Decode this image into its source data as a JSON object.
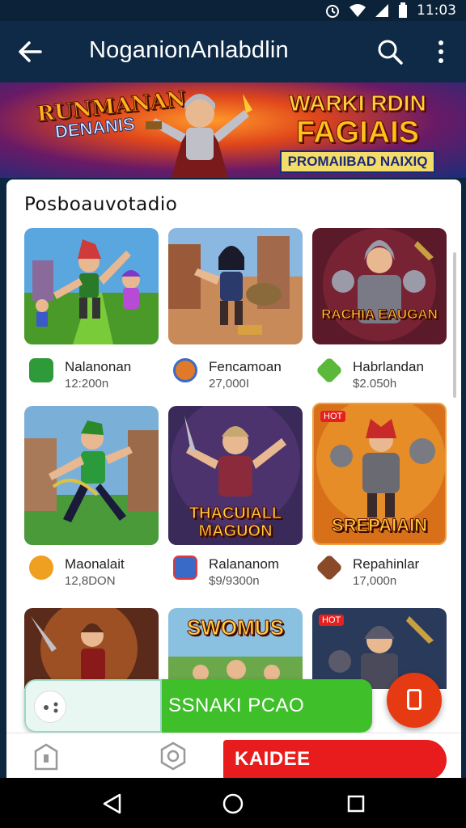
{
  "status": {
    "time": "11:03"
  },
  "app_bar": {
    "title": "NoganionAnlabdlin"
  },
  "banner": {
    "left_logo_line1": "RUNMANAN",
    "left_logo_line2": "DENANIS",
    "promo_line1": "WARKI RDIN",
    "promo_line2": "FAGIAIS",
    "promo_line3": "PROMAIIBAD NAIXIQ"
  },
  "section": {
    "title": "Posboauvotadio"
  },
  "tiles": [
    {
      "name": "Nalanonan",
      "count": "12:200n",
      "thumb_text": ""
    },
    {
      "name": "Fencamoan",
      "count": "27,000I",
      "thumb_text": ""
    },
    {
      "name": "Habrlandan",
      "count": "$2.050h",
      "thumb_text": "RACHIA EAUGAN"
    },
    {
      "name": "Maonalait",
      "count": "12,8DON",
      "thumb_text": ""
    },
    {
      "name": "Ralananom",
      "count": "$9/9300n",
      "thumb_text": "THACUIALL MAGUON"
    },
    {
      "name": "Repahinlar",
      "count": "17,000n",
      "thumb_text": "SREPAIAIN"
    }
  ],
  "row3_thumb_text": "SWOMUS",
  "hot_badge": "HOT",
  "cta": {
    "label": "SSNAKI PCAO"
  },
  "bottom_nav": {
    "active_label": "KAIDEE"
  },
  "colors": {
    "app_bar": "#0f2a46",
    "cta_green": "#3fbf2a",
    "fab_red": "#e63a12",
    "active_tab_red": "#e81c1c"
  }
}
